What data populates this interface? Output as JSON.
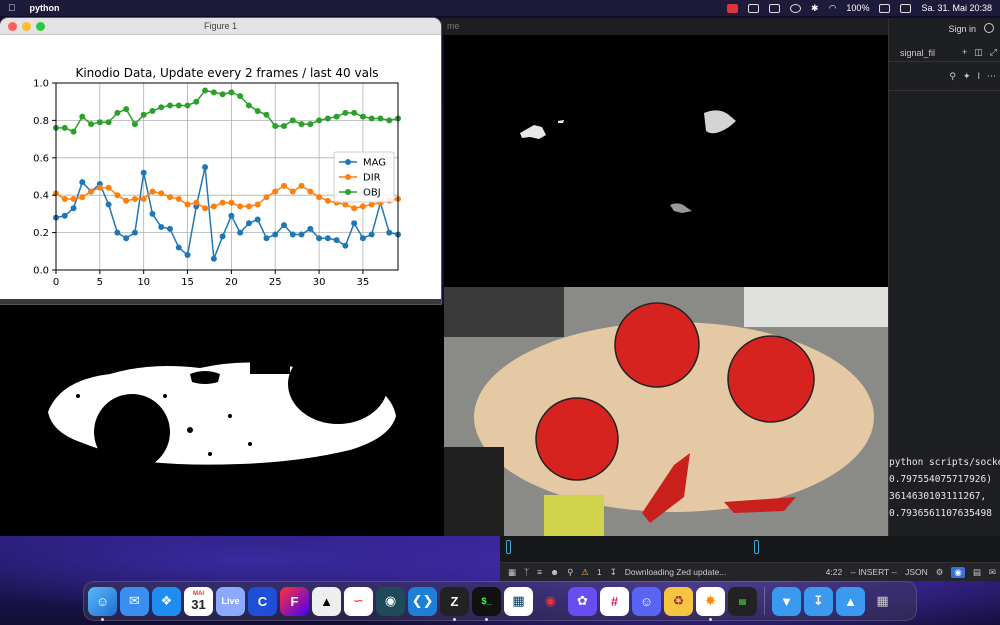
{
  "menubar": {
    "app_name": "python",
    "battery": "100%",
    "clock": "Sa. 31. Mai  20:38"
  },
  "figure": {
    "window_title": "Figure 1",
    "behind_title_fragment": "me",
    "toolbar_icons": [
      "home-icon",
      "back-icon",
      "forward-icon",
      "pan-icon",
      "zoom-icon",
      "configure-icon",
      "save-icon"
    ]
  },
  "chart_data": {
    "type": "line",
    "title": "Kinodio Data, Update every 2 frames / last 40 vals",
    "xlabel": "",
    "ylabel": "",
    "xlim": [
      0,
      39
    ],
    "ylim": [
      0.0,
      1.0
    ],
    "xticks": [
      0,
      5,
      10,
      15,
      20,
      25,
      30,
      35
    ],
    "yticks": [
      "0.0",
      "0.2",
      "0.4",
      "0.6",
      "0.8",
      "1.0"
    ],
    "grid": true,
    "legend": "center-right",
    "series": [
      {
        "name": "MAG",
        "color": "#1f77b4",
        "values": [
          0.28,
          0.29,
          0.33,
          0.47,
          0.42,
          0.46,
          0.35,
          0.2,
          0.17,
          0.2,
          0.52,
          0.3,
          0.23,
          0.22,
          0.12,
          0.08,
          0.34,
          0.55,
          0.06,
          0.18,
          0.29,
          0.2,
          0.25,
          0.27,
          0.17,
          0.19,
          0.24,
          0.19,
          0.19,
          0.22,
          0.17,
          0.17,
          0.16,
          0.13,
          0.25,
          0.17,
          0.19,
          0.36,
          0.2,
          0.19
        ]
      },
      {
        "name": "DIR",
        "color": "#ff7f0e",
        "values": [
          0.41,
          0.38,
          0.38,
          0.39,
          0.42,
          0.44,
          0.44,
          0.4,
          0.37,
          0.38,
          0.38,
          0.42,
          0.41,
          0.39,
          0.38,
          0.35,
          0.36,
          0.33,
          0.34,
          0.36,
          0.36,
          0.34,
          0.34,
          0.35,
          0.39,
          0.42,
          0.45,
          0.42,
          0.45,
          0.42,
          0.39,
          0.37,
          0.36,
          0.35,
          0.33,
          0.34,
          0.35,
          0.36,
          0.37,
          0.38
        ]
      },
      {
        "name": "OBJ",
        "color": "#2ca02c",
        "values": [
          0.76,
          0.76,
          0.74,
          0.82,
          0.78,
          0.79,
          0.79,
          0.84,
          0.86,
          0.78,
          0.83,
          0.85,
          0.87,
          0.88,
          0.88,
          0.88,
          0.9,
          0.96,
          0.95,
          0.94,
          0.95,
          0.93,
          0.88,
          0.85,
          0.83,
          0.77,
          0.77,
          0.8,
          0.78,
          0.78,
          0.8,
          0.81,
          0.82,
          0.84,
          0.84,
          0.82,
          0.81,
          0.81,
          0.8,
          0.81
        ]
      }
    ]
  },
  "editor": {
    "signin": "Sign in",
    "tab_label": "signal_fil",
    "terminal_lines": [
      "python scripts/socket_re",
      "0.797554075717926)",
      "3614630103111267,",
      "0.7936561107635498"
    ]
  },
  "zed_status": {
    "warnings": "1",
    "message": "Downloading Zed update...",
    "cursor": "4:22",
    "mode": "-- INSERT --",
    "language": "JSON"
  },
  "dock": {
    "calendar_month": "MAI",
    "calendar_day": "31",
    "live_label": "Live"
  }
}
